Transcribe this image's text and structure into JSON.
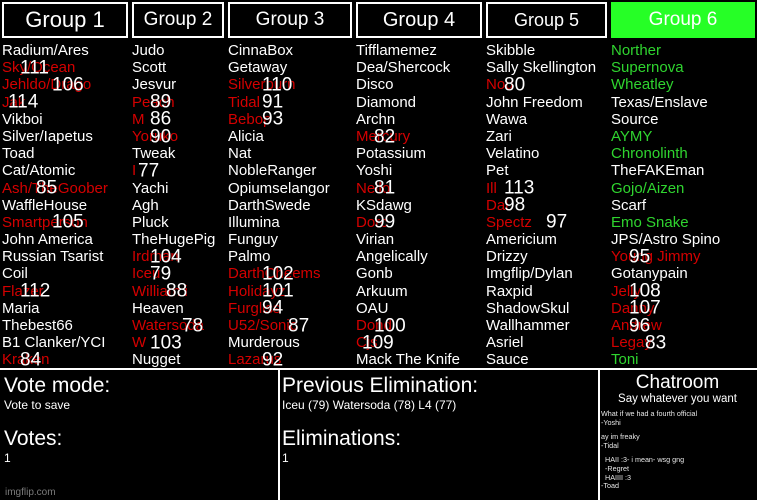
{
  "groups": [
    {
      "id": "group-1",
      "title": "Group 1",
      "highlight": false,
      "members": [
        {
          "name": "Radium/Ares",
          "status": "alive",
          "number": null
        },
        {
          "name": "Sky/Ocean",
          "status": "elim",
          "number": "111",
          "numoff": 1
        },
        {
          "name": "Jehldo/Drago",
          "status": "elim",
          "number": "106",
          "numoff": 3
        },
        {
          "name": "Jak",
          "status": "elim",
          "number": "114",
          "numoff": 0
        },
        {
          "name": "Vikboi",
          "status": "alive",
          "number": null
        },
        {
          "name": "Silver/Iapetus",
          "status": "alive",
          "number": null
        },
        {
          "name": "Toad",
          "status": "alive",
          "number": null
        },
        {
          "name": "Cat/Atomic",
          "status": "alive",
          "number": null
        },
        {
          "name": "Ash/TheGoober",
          "status": "elim",
          "number": "85",
          "numoff": 2
        },
        {
          "name": "WaffleHouse",
          "status": "alive",
          "number": null
        },
        {
          "name": "Smartperson",
          "status": "elim",
          "number": "105",
          "numoff": 3
        },
        {
          "name": "John America",
          "status": "alive",
          "number": null
        },
        {
          "name": "Russian Tsarist",
          "status": "alive",
          "number": null
        },
        {
          "name": "Coil",
          "status": "alive",
          "number": null
        },
        {
          "name": "Flazer",
          "status": "elim",
          "number": "112",
          "numoff": 1
        },
        {
          "name": "Maria",
          "status": "alive",
          "number": null
        },
        {
          "name": "Thebest66",
          "status": "alive",
          "number": null
        },
        {
          "name": "B1 Clanker/YCI",
          "status": "alive",
          "number": null
        },
        {
          "name": "Kraken",
          "status": "elim",
          "number": "84",
          "numoff": 1
        }
      ]
    },
    {
      "id": "group-2",
      "title": "Group 2",
      "highlight": false,
      "members": [
        {
          "name": "Judo",
          "status": "alive",
          "number": null
        },
        {
          "name": "Scott",
          "status": "alive",
          "number": null
        },
        {
          "name": "Jesvur",
          "status": "alive",
          "number": null
        },
        {
          "name": "Peach",
          "status": "elim",
          "number": "89",
          "numoff": 1
        },
        {
          "name": "M",
          "status": "elim",
          "number": "86",
          "numoff": 1
        },
        {
          "name": "Yoruko",
          "status": "elim",
          "number": "90",
          "numoff": 1
        },
        {
          "name": "Tweak",
          "status": "alive",
          "number": null
        },
        {
          "name": "I",
          "status": "elim",
          "number": "77",
          "numoff": 0
        },
        {
          "name": "Yachi",
          "status": "alive",
          "number": null
        },
        {
          "name": "Agh",
          "status": "alive",
          "number": null
        },
        {
          "name": "Pluck",
          "status": "alive",
          "number": null
        },
        {
          "name": "TheHugePig",
          "status": "alive",
          "number": null
        },
        {
          "name": "Irdman",
          "status": "elim",
          "number": "104",
          "numoff": 1
        },
        {
          "name": "Iceu",
          "status": "elim",
          "number": "79",
          "numoff": 1
        },
        {
          "name": "William i",
          "status": "elim",
          "number": "88",
          "numoff": 2
        },
        {
          "name": "Heaven",
          "status": "alive",
          "number": null
        },
        {
          "name": "Watersoda",
          "status": "elim",
          "number": "78",
          "numoff": 3
        },
        {
          "name": "W",
          "status": "elim",
          "number": "103",
          "numoff": 1
        },
        {
          "name": "Nugget",
          "status": "alive",
          "number": null
        }
      ]
    },
    {
      "id": "group-3",
      "title": "Group 3",
      "highlight": false,
      "members": [
        {
          "name": "CinnaBox",
          "status": "alive",
          "number": null
        },
        {
          "name": "Getaway",
          "status": "alive",
          "number": null
        },
        {
          "name": "Silverburn",
          "status": "elim",
          "number": "110",
          "numoff": 2
        },
        {
          "name": "Tidal",
          "status": "elim",
          "number": "91",
          "numoff": 2
        },
        {
          "name": "Bebop",
          "status": "elim",
          "number": "93",
          "numoff": 2
        },
        {
          "name": "Alicia",
          "status": "alive",
          "number": null
        },
        {
          "name": "Nat",
          "status": "alive",
          "number": null
        },
        {
          "name": "NobleRanger",
          "status": "alive",
          "number": null
        },
        {
          "name": "Opiumselangor",
          "status": "alive",
          "number": null
        },
        {
          "name": "DarthSwede",
          "status": "alive",
          "number": null
        },
        {
          "name": "Illumina",
          "status": "alive",
          "number": null
        },
        {
          "name": "Funguy",
          "status": "alive",
          "number": null
        },
        {
          "name": "Palmo",
          "status": "alive",
          "number": null
        },
        {
          "name": "DarthCheems",
          "status": "elim",
          "number": "102",
          "numoff": 2
        },
        {
          "name": "Holidayz",
          "status": "elim",
          "number": "101",
          "numoff": 2
        },
        {
          "name": "Furgliss",
          "status": "elim",
          "number": "94",
          "numoff": 2
        },
        {
          "name": "U52/Sonic",
          "status": "elim",
          "number": "87",
          "numoff": 4
        },
        {
          "name": "Murderous",
          "status": "alive",
          "number": null
        },
        {
          "name": "Lazarus",
          "status": "elim",
          "number": "92",
          "numoff": 2
        }
      ]
    },
    {
      "id": "group-4",
      "title": "Group 4",
      "highlight": false,
      "members": [
        {
          "name": "Tifflamemez",
          "status": "alive",
          "number": null
        },
        {
          "name": "Dea/Shercock",
          "status": "alive",
          "number": null
        },
        {
          "name": "Disco",
          "status": "alive",
          "number": null
        },
        {
          "name": "Diamond",
          "status": "alive",
          "number": null
        },
        {
          "name": "Archn",
          "status": "alive",
          "number": null
        },
        {
          "name": "Mercury",
          "status": "elim",
          "number": "82",
          "numoff": 1
        },
        {
          "name": "Potassium",
          "status": "alive",
          "number": null
        },
        {
          "name": "Yoshi",
          "status": "alive",
          "number": null
        },
        {
          "name": "Nello",
          "status": "elim",
          "number": "81",
          "numoff": 1
        },
        {
          "name": "KSdawg",
          "status": "alive",
          "number": null
        },
        {
          "name": "Dorc",
          "status": "elim",
          "number": "99",
          "numoff": 1
        },
        {
          "name": "Virian",
          "status": "alive",
          "number": null
        },
        {
          "name": "Angelically",
          "status": "alive",
          "number": null
        },
        {
          "name": "Gonb",
          "status": "alive",
          "number": null
        },
        {
          "name": "Arkuum",
          "status": "alive",
          "number": null
        },
        {
          "name": "OAU",
          "status": "alive",
          "number": null
        },
        {
          "name": "Dond",
          "status": "elim",
          "number": "100",
          "numoff": 1
        },
        {
          "name": "Cjs",
          "status": "elim",
          "number": "109",
          "numoff": 0
        },
        {
          "name": "Mack The Knife",
          "status": "alive",
          "number": null
        }
      ]
    },
    {
      "id": "group-5",
      "title": "Group 5",
      "highlight": false,
      "members": [
        {
          "name": "Skibble",
          "status": "alive",
          "number": null
        },
        {
          "name": "Sally Skellington",
          "status": "alive",
          "number": null
        },
        {
          "name": "Nou",
          "status": "elim",
          "number": "80",
          "numoff": 1
        },
        {
          "name": "John Freedom",
          "status": "alive",
          "number": null
        },
        {
          "name": "Wawa",
          "status": "alive",
          "number": null
        },
        {
          "name": "Zari",
          "status": "alive",
          "number": null
        },
        {
          "name": "Velatino",
          "status": "alive",
          "number": null
        },
        {
          "name": "Pet",
          "status": "alive",
          "number": null
        },
        {
          "name": "Ill",
          "status": "elim",
          "number": "113",
          "numoff": 1
        },
        {
          "name": "Dal",
          "status": "elim",
          "number": "98",
          "numoff": 1
        },
        {
          "name": "Spectz",
          "status": "elim",
          "number": "97",
          "numoff": 4
        },
        {
          "name": "Americium",
          "status": "alive",
          "number": null
        },
        {
          "name": "Drizzy",
          "status": "alive",
          "number": null
        },
        {
          "name": "Imgflip/Dylan",
          "status": "alive",
          "number": null
        },
        {
          "name": "Raxpid",
          "status": "alive",
          "number": null
        },
        {
          "name": "ShadowSkul",
          "status": "alive",
          "number": null
        },
        {
          "name": "Wallhammer",
          "status": "alive",
          "number": null
        },
        {
          "name": "Asriel",
          "status": "alive",
          "number": null
        },
        {
          "name": "Sauce",
          "status": "alive",
          "number": null
        }
      ]
    },
    {
      "id": "group-6",
      "title": "Group 6",
      "highlight": true,
      "members": [
        {
          "name": "Norther",
          "status": "green",
          "number": null
        },
        {
          "name": "Supernova",
          "status": "green",
          "number": null
        },
        {
          "name": "Wheatley",
          "status": "green",
          "number": null
        },
        {
          "name": "Texas/Enslave",
          "status": "alive",
          "number": null
        },
        {
          "name": "Source",
          "status": "alive",
          "number": null
        },
        {
          "name": "AYMY",
          "status": "green",
          "number": null
        },
        {
          "name": "Chronolinth",
          "status": "green",
          "number": null
        },
        {
          "name": "TheFAKEman",
          "status": "alive",
          "number": null
        },
        {
          "name": "Gojo/Aizen",
          "status": "green",
          "number": null
        },
        {
          "name": "Scarf",
          "status": "alive",
          "number": null
        },
        {
          "name": "Emo Snake",
          "status": "green",
          "number": null
        },
        {
          "name": "JPS/Astro Spino",
          "status": "alive",
          "number": null
        },
        {
          "name": "Young Jimmy",
          "status": "elim",
          "number": "95",
          "numoff": 1
        },
        {
          "name": "Gotanypain",
          "status": "alive",
          "number": null
        },
        {
          "name": "Jelly",
          "status": "elim",
          "number": "108",
          "numoff": 1
        },
        {
          "name": "Danny",
          "status": "elim",
          "number": "107",
          "numoff": 1
        },
        {
          "name": "Andrew",
          "status": "elim",
          "number": "96",
          "numoff": 1
        },
        {
          "name": "Legay",
          "status": "elim",
          "number": "83",
          "numoff": 2
        },
        {
          "name": "Toni",
          "status": "green",
          "number": null
        }
      ]
    }
  ],
  "vote_panel": {
    "mode_title": "Vote mode:",
    "mode_value": "Vote to save",
    "votes_title": "Votes:",
    "votes_value": "1"
  },
  "previous_panel": {
    "prev_title": "Previous Elimination:",
    "prev_value": "Iceu (79) Watersoda (78) L4 (77)",
    "elim_title": "Eliminations:",
    "elim_value": "1"
  },
  "chatroom": {
    "title": "Chatroom",
    "subtitle": "Say whatever you want",
    "messages": [
      {
        "text": "What if we had a fourth official",
        "indent": false
      },
      {
        "text": "-Yoshi",
        "indent": false
      },
      {
        "text": "",
        "indent": false
      },
      {
        "text": "ay im freaky",
        "indent": false
      },
      {
        "text": "-Tidal",
        "indent": false
      },
      {
        "text": "",
        "indent": false
      },
      {
        "text": "HAII :3- i mean- wsg gng",
        "indent": true
      },
      {
        "text": "-Regret",
        "indent": true
      },
      {
        "text": "HAIIII :3",
        "indent": true
      },
      {
        "text": "-Toad",
        "indent": false
      }
    ]
  },
  "watermark": "imgflip.com",
  "colors": {
    "eliminated": "#d40000",
    "alive": "#ffffff",
    "safe_green": "#2fd42f",
    "header_highlight": "#26ff26",
    "background": "#000000"
  }
}
